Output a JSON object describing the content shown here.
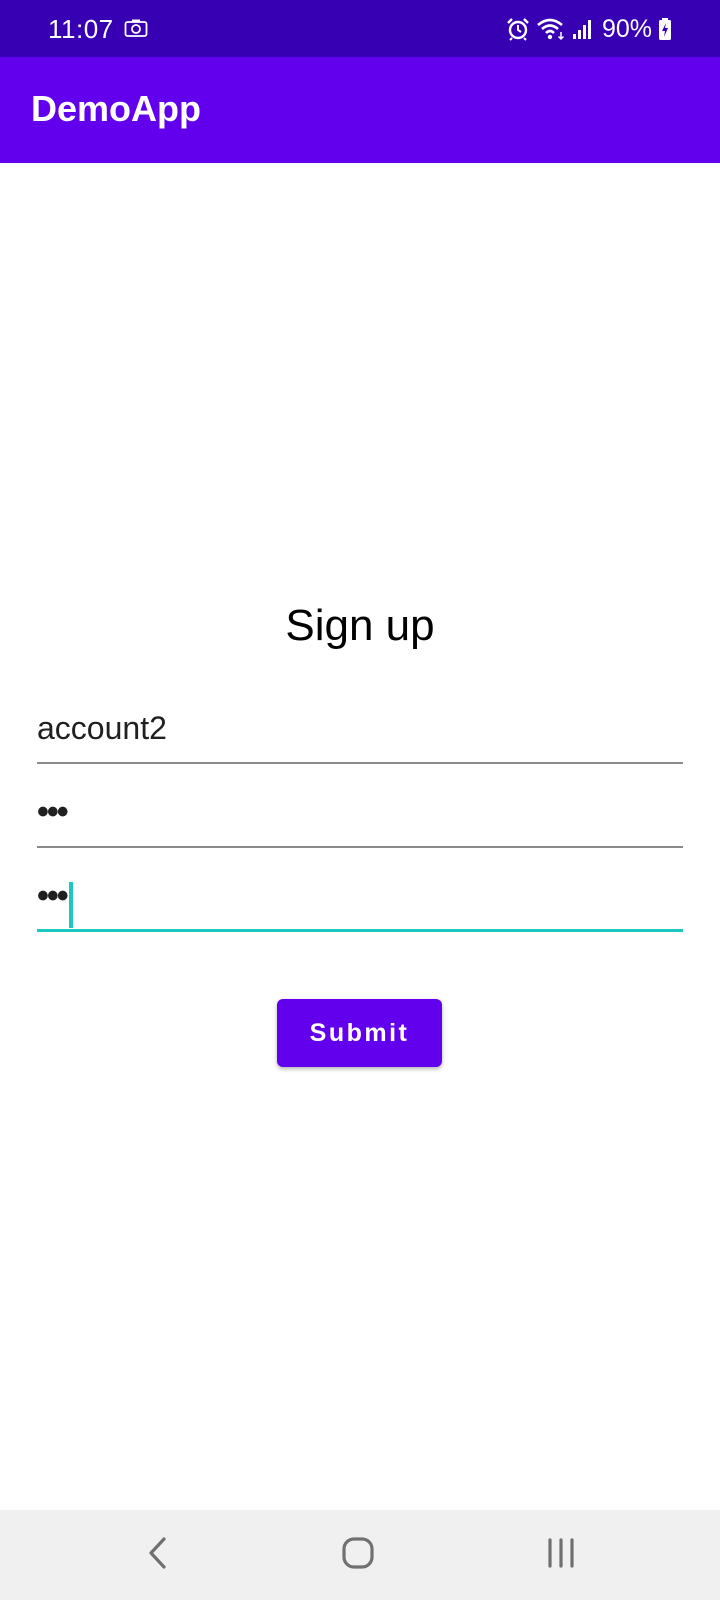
{
  "status_bar": {
    "time": "11:07",
    "battery": "90%",
    "icons": [
      "camera-icon",
      "alarm-icon",
      "wifi-icon",
      "signal-icon",
      "battery-charging-icon"
    ]
  },
  "app_bar": {
    "title": "DemoApp"
  },
  "form": {
    "title": "Sign up",
    "username_value": "account2",
    "password_value": "•••",
    "confirm_password_value": "•••",
    "submit_label": "Submit"
  },
  "nav_bar": {
    "buttons": [
      "back-icon",
      "home-icon",
      "recents-icon"
    ]
  },
  "colors": {
    "status_bar": "#3700b3",
    "primary": "#6200ee",
    "focus_accent": "#1cc7c0",
    "nav_bar": "#f0f0f0"
  }
}
